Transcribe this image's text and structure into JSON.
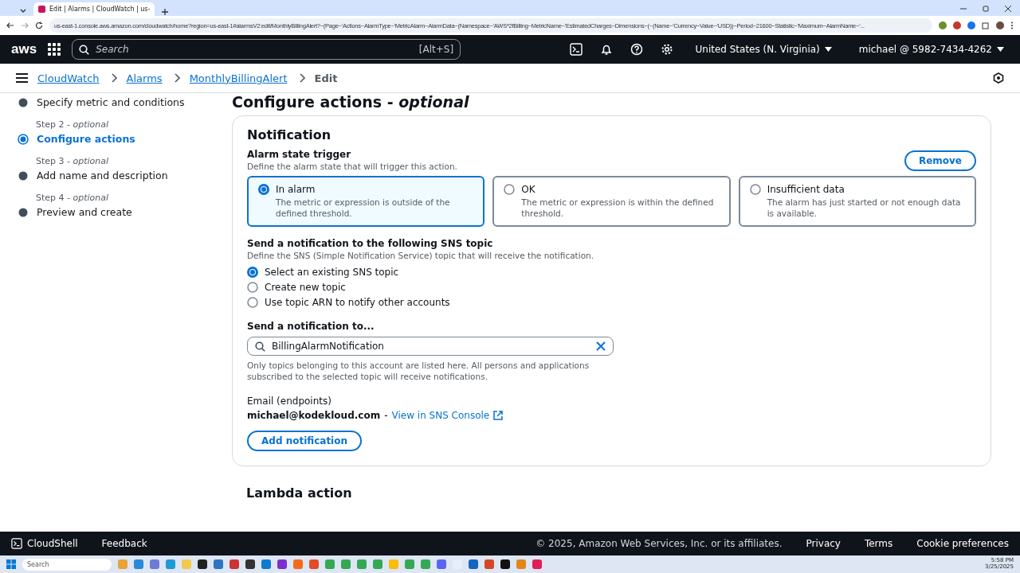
{
  "browser": {
    "tab_title": "Edit | Alarms | CloudWatch | us-",
    "url": "us-east-1.console.aws.amazon.com/cloudwatch/home?region=us-east-1#alarmsV2:edit/MonthlyBillingAlert?~(Page~'Actions~AlarmType~'MetricAlarm~AlarmData~(Namespace~'AWS*2fBilling~MetricName~'EstimatedCharges~Dimensions~(~(Name~'Currency~Value~'USD))~Period~21600~Statistic~'Maximum~AlarmName~'..."
  },
  "topnav": {
    "logo": "aws",
    "search_placeholder": "Search",
    "search_shortcut": "[Alt+S]",
    "region": "United States (N. Virginia)",
    "account": "michael @ 5982-7434-4262"
  },
  "breadcrumbs": [
    {
      "label": "CloudWatch",
      "kind": "link"
    },
    {
      "label": "Alarms",
      "kind": "link"
    },
    {
      "label": "MonthlyBillingAlert",
      "kind": "link"
    },
    {
      "label": "Edit",
      "kind": "current"
    }
  ],
  "steps": [
    {
      "title": "Specify metric and conditions",
      "selected": false
    },
    {
      "label": "Step 2 - *optional*",
      "title": "Configure actions",
      "selected": true
    },
    {
      "label": "Step 3 - *optional*",
      "title": "Add name and description",
      "selected": false
    },
    {
      "label": "Step 4 - *optional*",
      "title": "Preview and create",
      "selected": false
    }
  ],
  "page_heading": "Configure actions - *optional*",
  "notification": {
    "title": "Notification",
    "remove_button": "Remove",
    "trigger": {
      "label": "Alarm state trigger",
      "description": "Define the alarm state that will trigger this action.",
      "options": [
        {
          "title": "In alarm",
          "description": "The metric or expression is outside of the defined threshold.",
          "selected": true
        },
        {
          "title": "OK",
          "description": "The metric or expression is within the defined threshold.",
          "selected": false
        },
        {
          "title": "Insufficient data",
          "description": "The alarm has just started or not enough data is available.",
          "selected": false
        }
      ]
    },
    "sns": {
      "label": "Send a notification to the following SNS topic",
      "description": "Define the SNS (Simple Notification Service) topic that will receive the notification.",
      "options": [
        {
          "label": "Select an existing SNS topic",
          "selected": true
        },
        {
          "label": "Create new topic",
          "selected": false
        },
        {
          "label": "Use topic ARN to notify other accounts",
          "selected": false
        }
      ]
    },
    "send_to": {
      "label": "Send a notification to...",
      "value": "BillingAlarmNotification",
      "hint": "Only topics belonging to this account are listed here. All persons and applications subscribed to the selected topic will receive notifications."
    },
    "email_label": "Email (endpoints)",
    "email": "michael@kodekloud.com",
    "separator": "-",
    "console_link": "View in SNS Console",
    "add_button": "Add notification"
  },
  "lambda": {
    "title": "Lambda action"
  },
  "footer": {
    "cloudshell": "CloudShell",
    "feedback": "Feedback",
    "copyright": "© 2025, Amazon Web Services, Inc. or its affiliates.",
    "links": [
      "Privacy",
      "Terms",
      "Cookie preferences"
    ]
  },
  "taskbar": {
    "search_placeholder": "Search",
    "time": "5:58 PM",
    "date": "3/25/2025"
  }
}
